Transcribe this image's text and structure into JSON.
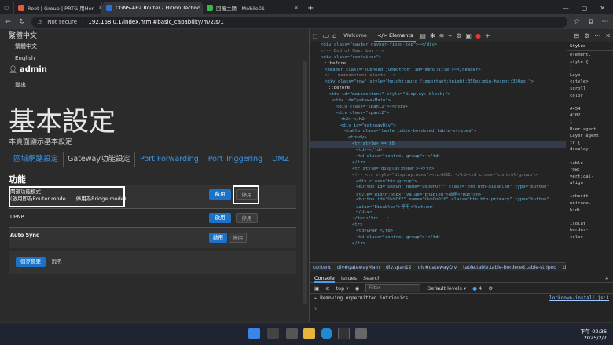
{
  "tabs": [
    {
      "title": "Root | Group | PRTG 用Her",
      "color": "#e55a3c"
    },
    {
      "title": "CGN5-AP2 Router - Hitron Techno",
      "color": "#2f6fd6"
    },
    {
      "title": "回覆主題 - Mobile01",
      "color": "#3ab54a"
    }
  ],
  "address": {
    "warning": "Not secure",
    "url": "192.168.0.1/index.html#basic_capability/m/2/s/1"
  },
  "menu": {
    "lang_current": "繁體中文",
    "lang_options": [
      "繁體中文",
      "English"
    ],
    "user": "admin",
    "logout": "登出"
  },
  "page": {
    "title": "基本設定",
    "subtitle": "本頁面顯示基本設定",
    "tabs": [
      "區域網路設定",
      "Gateway功能設定",
      "Port Forwarding",
      "Port Triggering",
      "DMZ"
    ],
    "section": "功能",
    "rows": [
      {
        "label": "閘道功能模式",
        "sub": "(啟用即為Router mode　　停用為Bridge mode)",
        "on": "啟用",
        "off": "停用"
      },
      {
        "label": "UPNP",
        "sub": "",
        "on": "啟用",
        "off": "停用"
      },
      {
        "label": "Auto Sync",
        "sub": "",
        "on": "啟用",
        "off": "停用"
      }
    ],
    "save": "儲存變更",
    "help": "說明"
  },
  "devtools": {
    "tabs": [
      "Welcome",
      "Elements"
    ],
    "badge": "1",
    "lines": [
      "<div class=\"navbar navbar-fixed-top\">⋯</div>",
      "<!-- End of Navi bar -->",
      "<div class=\"container\">",
      "::before",
      "<header class=\"subhead jumbotron\" id=\"menuTitle\">⋯</header>",
      "<!-- maincontent starts -->",
      "<div class=\"row\" style=\"height:auto !important;height:350px;min-height:350px;\">",
      "::before",
      "<div id=\"maincontent\" style=\"display: block;\">",
      "<div id=\"gatewayMain\">",
      "<div class=\"span12\">⋯</div>",
      "<div class=\"span12\">",
      "<h2>⋯</h2>",
      "<div id=\"gatewayDiv\">",
      "<table class=\"table table-bordered table-striped\">",
      "<tbody>",
      "<tr style> == $0",
      "<td>⋯</td>",
      "<td class=\"control-group\">⋯</td>",
      "</tr>",
      "<tr style=\"display:none\">⋯</tr>",
      "<!-- <tr style=\"display:none\"><td>USB: </td><td class=\"control-group\">",
      "<div class=\"btn-group\">",
      "<button id=\"UsbOn\" name=\"UsbOnOff\" class=\"btn btn-disabled\" type=\"button\"",
      "style=\"width:60px\" value=\"Enabled\">啟用</button>",
      "<button id=\"UsbOff\" name=\"UsbOnOff\" class=\"btn btn-primary\" type=\"button\"",
      "value=\"Disabled\">停用</button>",
      "</div>",
      "</td></tr>  -->",
      "<tr>",
      "<td>UPNP </td>",
      "<td class=\"control-group\">⋯</td>",
      "</tr>"
    ],
    "breadcrumbs": [
      "content",
      "div#gatewayMain",
      "div.span12",
      "div#gatewayDiv",
      "table.table.table-bordered.table-striped",
      "tbody",
      "tr"
    ],
    "styles": {
      "tab": "Styles",
      "lines": [
        "element.",
        "style {",
        "}",
        "Layo",
        "<style>",
        "scroll",
        "color",
        ":",
        "#454",
        "#202",
        "}",
        "User agent",
        "Layer agent",
        "tr {",
        "display",
        ":",
        "table-",
        "row;",
        "vertical-",
        "align",
        ":",
        "inherit",
        "unicode-",
        "bidi",
        ":",
        "isolat",
        "border-",
        "color",
        ":"
      ]
    },
    "console": {
      "tabs": [
        "Console",
        "Issues",
        "Search"
      ],
      "context": "top",
      "filter_placeholder": "Filter",
      "levels": "Default levels",
      "issues": "4",
      "message": "Removing unpermitted intrinsics",
      "source": "lockdown-install.js:1",
      "prompt": "›"
    }
  },
  "taskbar": {
    "time": "下午 02:36",
    "date": "2025/2/7"
  }
}
